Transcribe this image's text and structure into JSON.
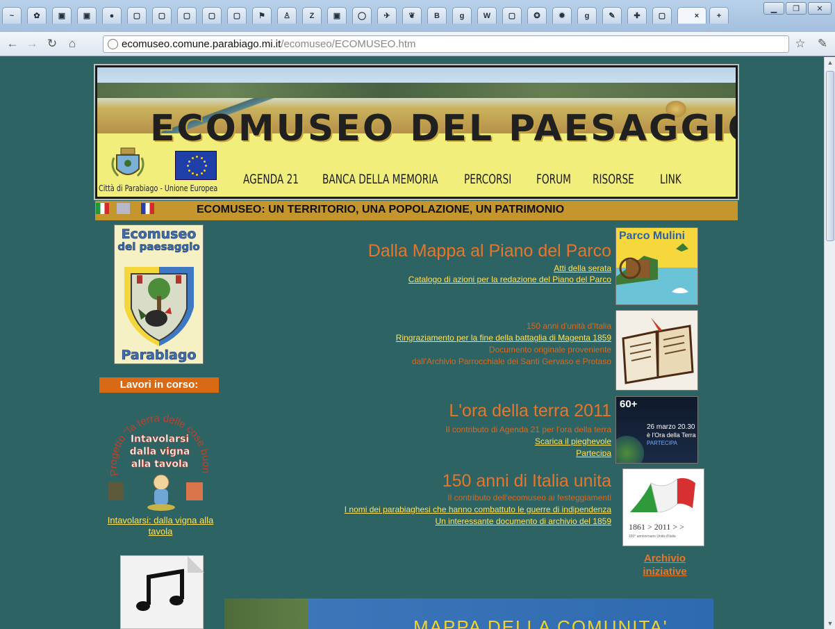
{
  "browser": {
    "tabs": [
      {
        "icon": "yandex-icon",
        "glyph": "~"
      },
      {
        "icon": "page-icon",
        "glyph": "✿"
      },
      {
        "icon": "crest-icon",
        "glyph": "▣"
      },
      {
        "icon": "crest-icon",
        "glyph": "▣"
      },
      {
        "icon": "globe-icon",
        "glyph": "●"
      },
      {
        "icon": "blank-page-icon",
        "glyph": "▢"
      },
      {
        "icon": "blank-page-icon",
        "glyph": "▢"
      },
      {
        "icon": "blank-page-icon",
        "glyph": "▢"
      },
      {
        "icon": "blank-page-icon",
        "glyph": "▢"
      },
      {
        "icon": "blank-page-icon",
        "glyph": "▢"
      },
      {
        "icon": "flag-icon",
        "glyph": "⚑"
      },
      {
        "icon": "figure-icon",
        "glyph": "♙"
      },
      {
        "icon": "z-icon",
        "glyph": "Z"
      },
      {
        "icon": "crest-icon",
        "glyph": "▣"
      },
      {
        "icon": "circle-icon",
        "glyph": "◯"
      },
      {
        "icon": "bird-icon",
        "glyph": "✈"
      },
      {
        "icon": "leaf-icon",
        "glyph": "❦"
      },
      {
        "icon": "b-icon",
        "glyph": "B"
      },
      {
        "icon": "google-icon",
        "glyph": "g"
      },
      {
        "icon": "wikipedia-icon",
        "glyph": "W"
      },
      {
        "icon": "blank-page-icon",
        "glyph": "▢"
      },
      {
        "icon": "panda-icon",
        "glyph": "✪"
      },
      {
        "icon": "sun-icon",
        "glyph": "✹"
      },
      {
        "icon": "google-icon",
        "glyph": "g"
      },
      {
        "icon": "paint-icon",
        "glyph": "✎"
      },
      {
        "icon": "plus-box-icon",
        "glyph": "✚"
      },
      {
        "icon": "blank-page-icon",
        "glyph": "▢"
      }
    ],
    "active_tab_close": "×",
    "new_tab": "+",
    "url_host": "ecomuseo.comune.parabiago.mi.it",
    "url_path": "/ecomuseo/ECOMUSEO.htm"
  },
  "banner": {
    "title": "ECOMUSEO DEL PAESAGGIO",
    "caption": "Città di Parabiago - Unione Europea",
    "menu": [
      "AGENDA 21",
      "BANCA DELLA MEMORIA",
      "PERCORSI",
      "FORUM",
      "RISORSE",
      "LINK"
    ]
  },
  "subtitle": "ECOMUSEO: UN TERRITORIO, UNA POPOLAZIONE, UN PATRIMONIO",
  "sidebar": {
    "logo_line1": "Ecomuseo",
    "logo_line2": "del paesaggio",
    "logo_bottom": "Parabiago",
    "lavori": "Lavori in corso:",
    "intavolarsi_arc": "Progetto \"la terra delle cose buone\"",
    "intavolarsi_lines": [
      "Intavolarsi",
      "dalla vigna",
      "alla tavola"
    ],
    "intavolarsi_link": "Intavolarsi: dalla vigna alla tavola"
  },
  "news": [
    {
      "title": "Dalla Mappa al Piano del Parco",
      "lines": [
        {
          "text": "Atti della serata",
          "link": true
        },
        {
          "text": "Catalogo di azioni per la redazione del Piano del Parco",
          "link": true
        }
      ],
      "thumb_label": "Parco Mulini"
    },
    {
      "title": "",
      "lines": [
        {
          "text": "150 anni d'unità d'Italia",
          "link": false
        },
        {
          "text": "Ringraziamento per la fine della battaglia di Magenta 1859",
          "link": true
        },
        {
          "text": "Documento originale proveniente",
          "link": false
        },
        {
          "text": "dall'Archivio Parrocchiale dei Santi Gervaso e Protaso",
          "link": false
        }
      ],
      "thumb_label": ""
    },
    {
      "title": "L'ora della terra 2011",
      "lines": [
        {
          "text": "Il contributo di Agenda 21 per l'ora della terra",
          "link": false
        },
        {
          "text": "Scarica il pieghevole",
          "link": true
        },
        {
          "text": "Partecipa",
          "link": true
        }
      ],
      "thumb_label": "60+",
      "thumb_lines": [
        "26 marzo 20.30",
        "è l'Ora della Terra",
        "PARTECIPA"
      ]
    },
    {
      "title": "150 anni di Italia unita",
      "lines": [
        {
          "text": "Il contributo dell'ecomuseo ai festeggiamenti",
          "link": false
        },
        {
          "text": "I nomi dei parabiaghesi che hanno combattuto le guerre di indipendenza",
          "link": true
        },
        {
          "text": "Un interessante documento di archivio del 1859",
          "link": true
        }
      ],
      "thumb_label": "1861 > 2011 > >",
      "thumb_sub": "150° anniversario Unità d'Italia"
    }
  ],
  "archivio": "Archivio iniziative",
  "mappa_title": "MAPPA DELLA COMUNITA'",
  "colors": {
    "page_bg": "#2e6364",
    "subbar": "#c5962e",
    "news_title": "#e8762a",
    "link": "#ffe35a",
    "lavori_bg": "#d86a15"
  }
}
